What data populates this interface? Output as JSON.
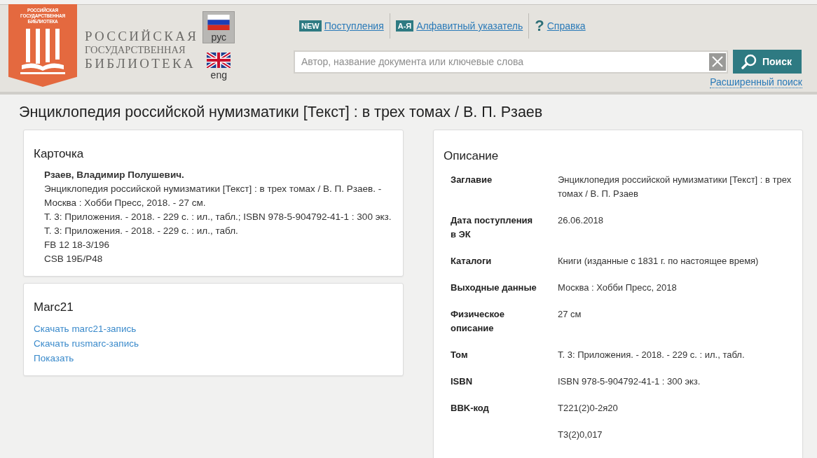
{
  "header": {
    "logo_emblem_lines": [
      "РОССИЙСКАЯ",
      "ГОСУДАРСТВЕННАЯ",
      "БИБЛИОТЕКА"
    ],
    "logo_name_lines": [
      "РОССИЙСКАЯ",
      "ГОСУДАРСТВЕННАЯ",
      "БИБЛИОТЕКА"
    ],
    "languages": [
      {
        "label": "рус",
        "selected": true
      },
      {
        "label": "eng",
        "selected": false
      }
    ],
    "nav": [
      {
        "badge": "NEW",
        "label": "Поступления"
      },
      {
        "badge": "А-Я",
        "label": "Алфавитный указатель"
      },
      {
        "glyph": "?",
        "label": "Справка"
      }
    ],
    "search": {
      "placeholder": "Автор, название документа или ключевые слова",
      "button": "Поиск"
    },
    "advanced_search": "Расширенный поиск"
  },
  "title": "Энциклопедия российской нумизматики [Текст] : в трех томах / В. П. Рзаев",
  "card": {
    "heading": "Карточка",
    "author": "Рзаев, Владимир Полушевич.",
    "lines": [
      "Энциклопедия российской нумизматики [Текст] : в трех томах / В. П. Рзаев. - Москва : Хобби Пресс, 2018. - 27 см.",
      "Т. 3: Приложения. - 2018. - 229 с. : ил., табл.; ISBN 978-5-904792-41-1 : 300 экз.",
      "Т. 3: Приложения. - 2018. - 229 с. : ил., табл.",
      "FB 12 18-3/196",
      "CSB 19Б/Р48"
    ]
  },
  "marc": {
    "heading": "Marc21",
    "links": [
      "Скачать marc21-запись",
      "Скачать rusmarc-запись",
      "Показать"
    ]
  },
  "description": {
    "heading": "Описание",
    "rows": [
      {
        "label": "Заглавие",
        "value": "Энциклопедия российской нумизматики [Текст] : в трех томах / В. П. Рзаев"
      },
      {
        "label": "Дата поступления в ЭК",
        "value": "26.06.2018"
      },
      {
        "label": "Каталоги",
        "value": "Книги (изданные с 1831 г. по настоящее время)"
      },
      {
        "label": "Выходные данные",
        "value": "Москва : Хобби Пресс, 2018"
      },
      {
        "label": "Физическое описание",
        "value": "27 см"
      },
      {
        "label": "Том",
        "value": "Т. 3: Приложения. - 2018. - 229 с. : ил., табл."
      },
      {
        "label": "ISBN",
        "value": "ISBN 978-5-904792-41-1 : 300 экз."
      },
      {
        "label": "BBK-код",
        "value": "Т221(2)0-2я20"
      },
      {
        "value": "Т3(2)0,017"
      }
    ]
  }
}
